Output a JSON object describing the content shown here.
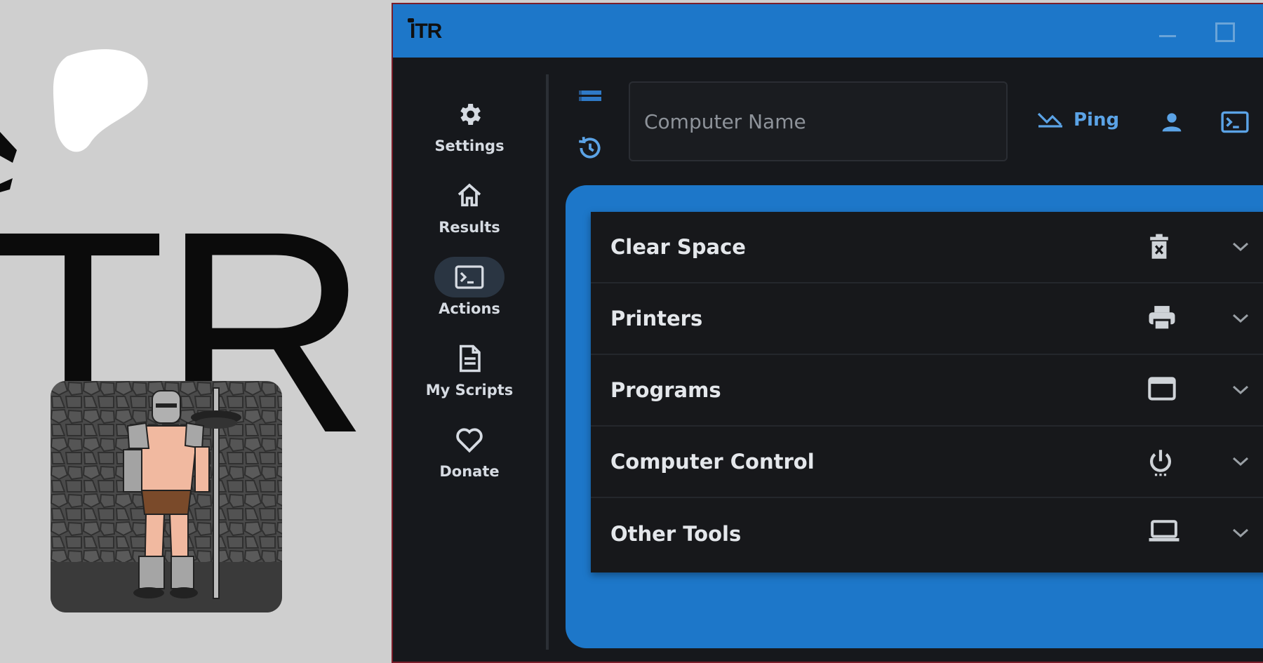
{
  "branding": {
    "logo_text": "TR",
    "mascot_name": "knight-with-barbell"
  },
  "window": {
    "title_logo": "ITR",
    "controls": [
      "minimize",
      "maximize"
    ]
  },
  "sidebar": {
    "items": [
      {
        "label": "Settings",
        "icon": "gear-icon",
        "active": false
      },
      {
        "label": "Results",
        "icon": "home-icon",
        "active": false
      },
      {
        "label": "Actions",
        "icon": "terminal-icon",
        "active": true
      },
      {
        "label": "My Scripts",
        "icon": "document-icon",
        "active": false
      },
      {
        "label": "Donate",
        "icon": "heart-icon",
        "active": false
      }
    ]
  },
  "toolbar": {
    "computer_name_placeholder": "Computer Name",
    "ping_label": "Ping",
    "icons": [
      "list-icon",
      "history-icon",
      "user-icon",
      "terminal-icon"
    ]
  },
  "actions": {
    "sections": [
      {
        "title": "Clear Space",
        "icon": "trash-icon"
      },
      {
        "title": "Printers",
        "icon": "printer-icon"
      },
      {
        "title": "Programs",
        "icon": "window-icon"
      },
      {
        "title": "Computer Control",
        "icon": "power-icon"
      },
      {
        "title": "Other Tools",
        "icon": "laptop-icon"
      }
    ]
  },
  "colors": {
    "accent": "#1d77c9",
    "background": "#16181c",
    "panel": "#17181b",
    "text": "#e4e7eb",
    "ping": "#5ba3e6"
  }
}
